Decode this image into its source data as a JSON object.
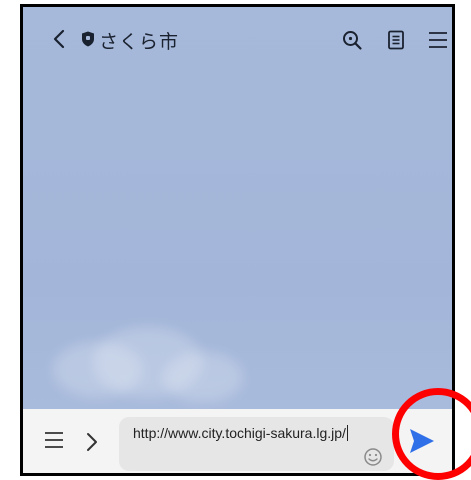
{
  "header": {
    "title": "さくら市",
    "back_icon": "back-chevron-icon",
    "account_icon": "shield-icon",
    "actions": [
      {
        "name": "search",
        "icon": "search-icon"
      },
      {
        "name": "notes",
        "icon": "note-icon"
      },
      {
        "name": "menu",
        "icon": "hamburger-menu-icon"
      }
    ]
  },
  "input_bar": {
    "menu_icon": "hamburger-menu-icon",
    "expand_icon": "chevron-right-icon",
    "message_value": "http://www.city.tochigi-sakura.lg.jp/",
    "emoji_icon": "emoji-smile-icon",
    "send_icon": "send-arrow-icon"
  },
  "colors": {
    "chat_background": "#a5b8da",
    "input_bar_background": "#f4f4f4",
    "text_box_background": "#e6e6e6",
    "send_accent": "#2f6fe8",
    "highlight_ring": "#ff0000"
  }
}
